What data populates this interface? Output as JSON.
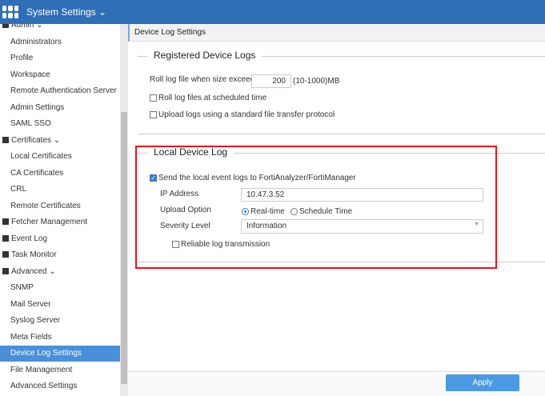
{
  "header": {
    "title": "System Settings"
  },
  "sidebar": {
    "items": [
      {
        "label": "Admin",
        "group": true
      },
      {
        "label": "Administrators"
      },
      {
        "label": "Profile"
      },
      {
        "label": "Workspace"
      },
      {
        "label": "Remote Authentication Server"
      },
      {
        "label": "Admin Settings"
      },
      {
        "label": "SAML SSO"
      },
      {
        "label": "Certificates",
        "group": true
      },
      {
        "label": "Local Certificates"
      },
      {
        "label": "CA Certificates"
      },
      {
        "label": "CRL"
      },
      {
        "label": "Remote Certificates"
      },
      {
        "label": "Fetcher Management",
        "group": true
      },
      {
        "label": "Event Log",
        "group": true
      },
      {
        "label": "Task Monitor",
        "group": true
      },
      {
        "label": "Advanced",
        "group": true
      },
      {
        "label": "SNMP"
      },
      {
        "label": "Mail Server"
      },
      {
        "label": "Syslog Server"
      },
      {
        "label": "Meta Fields"
      },
      {
        "label": "Device Log Settings",
        "selected": true
      },
      {
        "label": "File Management"
      },
      {
        "label": "Advanced Settings"
      }
    ]
  },
  "breadcrumb": "Device Log Settings",
  "registered": {
    "title": "Registered Device Logs",
    "roll_label": "Roll log file when size exceeds",
    "roll_value": "200",
    "roll_range": "(10-1000)MB",
    "scheduled": "Roll log files at scheduled time",
    "upload_std": "Upload logs using a standard file transfer protocol"
  },
  "local": {
    "title": "Local Device Log",
    "send": "Send the local event logs to FortiAnalyzer/FortiManager",
    "ip_label": "IP Address",
    "ip_value": "10.47.3.52",
    "upload_label": "Upload Option",
    "realtime": "Real-time",
    "schedule": "Schedule Time",
    "severity_label": "Severity Level",
    "severity_value": "Information",
    "reliable": "Reliable log transmission"
  },
  "footer": {
    "apply": "Apply"
  }
}
